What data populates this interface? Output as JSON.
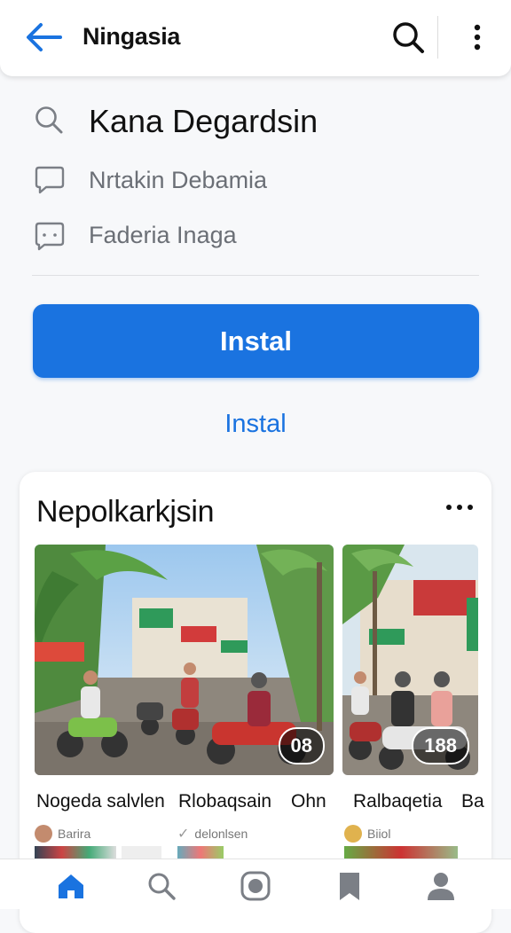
{
  "appbar": {
    "title": "Ningasia",
    "back_icon": "arrow-left-icon",
    "search_icon": "search-icon",
    "more_icon": "more-vertical-icon"
  },
  "results": [
    {
      "icon": "search-icon",
      "label": "Kana Degardsin"
    },
    {
      "icon": "chat-bubble-icon",
      "label": "Nrtakin Debamia"
    },
    {
      "icon": "message-icon",
      "label": "Faderia Inaga"
    }
  ],
  "actions": {
    "primary_label": "Instal",
    "secondary_label": "Instal"
  },
  "card": {
    "title": "Nepolkarkjsin",
    "more_icon": "more-horizontal-icon",
    "items": [
      {
        "badge": "08",
        "caption_a": "Nogeda salvlen",
        "caption_b": "Rlobaqsain",
        "caption_c": "Ohn",
        "meta": "Barira",
        "meta2": "delonlsen"
      },
      {
        "badge": "188",
        "caption_a": "Ralbaqetia",
        "caption_b": "Ba",
        "meta": "Biiol"
      }
    ]
  },
  "bottomnav": {
    "items": [
      {
        "icon": "home-icon",
        "active": true
      },
      {
        "icon": "search-icon",
        "active": false
      },
      {
        "icon": "camera-icon",
        "active": false
      },
      {
        "icon": "bookmark-icon",
        "active": false
      },
      {
        "icon": "profile-icon",
        "active": false
      }
    ]
  },
  "colors": {
    "accent": "#1a73e0",
    "muted_text": "#6b6f76"
  }
}
